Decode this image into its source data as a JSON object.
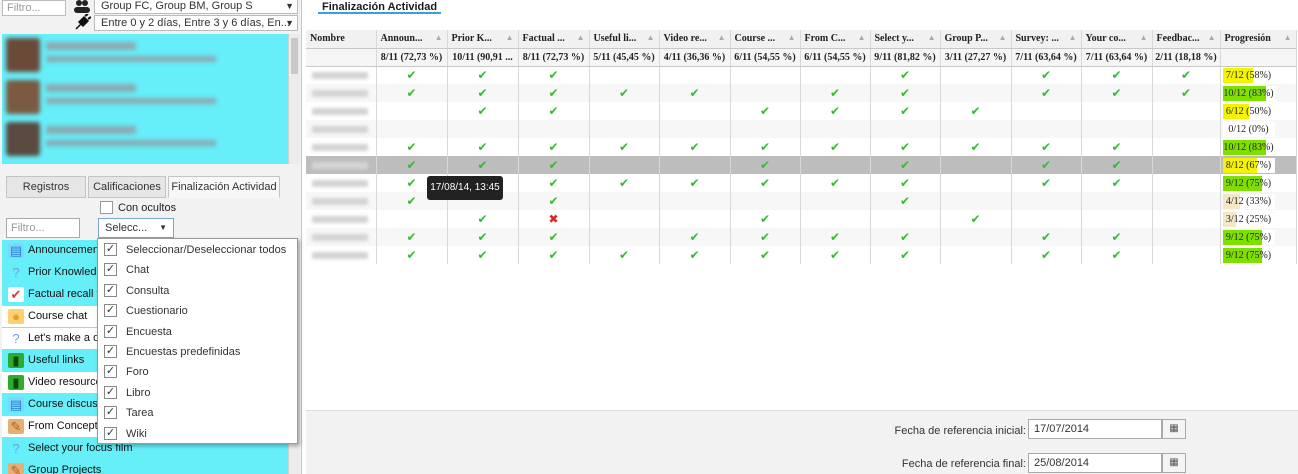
{
  "left": {
    "user_filter_placeholder": "Filtro...",
    "groups_combo": "Group FC, Group BM, Group S",
    "days_combo": "Entre 0 y 2 días, Entre 3 y 6 días, En...",
    "tabs": [
      "Registros",
      "Calificaciones",
      "Finalización Actividad"
    ],
    "show_hidden_label": "Con ocultos",
    "activity_filter_placeholder": "Filtro...",
    "select_button": "Selecc...",
    "activities": [
      {
        "label": "Announcements",
        "icon": "forum-icon"
      },
      {
        "label": "Prior Knowledge",
        "icon": "help-icon"
      },
      {
        "label": "Factual recall test",
        "icon": "quiz-icon"
      },
      {
        "label": "Course chat",
        "icon": "chat-icon"
      },
      {
        "label": "Let's make a date",
        "icon": "help-icon"
      },
      {
        "label": "Useful links",
        "icon": "book-icon"
      },
      {
        "label": "Video resources",
        "icon": "book-icon"
      },
      {
        "label": "Course discussion",
        "icon": "forum-icon"
      },
      {
        "label": "From Concept to Screen",
        "icon": "assignment-icon"
      },
      {
        "label": "Select your focus film",
        "icon": "help-icon"
      },
      {
        "label": "Group Projects",
        "icon": "assignment-icon"
      }
    ],
    "dropdown": [
      {
        "label": "Seleccionar/Deseleccionar todos",
        "checked": true
      },
      {
        "label": "Chat",
        "checked": true
      },
      {
        "label": "Consulta",
        "checked": true
      },
      {
        "label": "Cuestionario",
        "checked": true
      },
      {
        "label": "Encuesta",
        "checked": true
      },
      {
        "label": "Encuestas predefinidas",
        "checked": true
      },
      {
        "label": "Foro",
        "checked": true
      },
      {
        "label": "Libro",
        "checked": true
      },
      {
        "label": "Tarea",
        "checked": true
      },
      {
        "label": "Wiki",
        "checked": true
      }
    ]
  },
  "main": {
    "tab_label": "Finalización Actividad",
    "columns": [
      {
        "header": "Nombre",
        "sub": ""
      },
      {
        "header": "Announ...",
        "sub": "8/11 (72,73 %)"
      },
      {
        "header": "Prior K...",
        "sub": "10/11 (90,91 ..."
      },
      {
        "header": "Factual ...",
        "sub": "8/11 (72,73 %)"
      },
      {
        "header": "Useful li...",
        "sub": "5/11 (45,45 %)"
      },
      {
        "header": "Video re...",
        "sub": "4/11 (36,36 %)"
      },
      {
        "header": "Course ...",
        "sub": "6/11 (54,55 %)"
      },
      {
        "header": "From C...",
        "sub": "6/11 (54,55 %)"
      },
      {
        "header": "Select y...",
        "sub": "9/11 (81,82 %)"
      },
      {
        "header": "Group P...",
        "sub": "3/11 (27,27 %)"
      },
      {
        "header": "Survey: ...",
        "sub": "7/11 (63,64 %)"
      },
      {
        "header": "Your co...",
        "sub": "7/11 (63,64 %)"
      },
      {
        "header": "Feedbac...",
        "sub": "2/11 (18,18 %)"
      },
      {
        "header": "Progresión",
        "sub": ""
      }
    ],
    "rows": [
      {
        "cells": [
          1,
          1,
          1,
          0,
          0,
          0,
          0,
          1,
          0,
          1,
          1,
          1
        ],
        "progress": "7/12 (58%)",
        "fraction": 0.58,
        "color": "#f4f400"
      },
      {
        "cells": [
          1,
          1,
          1,
          1,
          1,
          0,
          1,
          1,
          0,
          1,
          1,
          1
        ],
        "progress": "10/12 (83%)",
        "fraction": 0.83,
        "color": "#7fe000"
      },
      {
        "cells": [
          0,
          1,
          1,
          0,
          0,
          1,
          1,
          1,
          1,
          0,
          0,
          0
        ],
        "progress": "6/12 (50%)",
        "fraction": 0.5,
        "color": "#f4f400"
      },
      {
        "cells": [
          0,
          0,
          0,
          0,
          0,
          0,
          0,
          0,
          0,
          0,
          0,
          0
        ],
        "progress": "0/12 (0%)",
        "fraction": 0,
        "color": "#ffffff"
      },
      {
        "cells": [
          1,
          1,
          1,
          1,
          1,
          1,
          1,
          1,
          1,
          1,
          1,
          0
        ],
        "progress": "10/12 (83%)",
        "fraction": 0.83,
        "color": "#7fe000"
      },
      {
        "cells": [
          1,
          1,
          1,
          0,
          0,
          1,
          0,
          1,
          0,
          1,
          1,
          0
        ],
        "progress": "8/12 (67%)",
        "fraction": 0.67,
        "color": "#f4f400"
      },
      {
        "cells": [
          1,
          1,
          1,
          1,
          1,
          1,
          1,
          1,
          0,
          1,
          1,
          0
        ],
        "progress": "9/12 (75%)",
        "fraction": 0.75,
        "color": "#7fe000"
      },
      {
        "cells": [
          1,
          0,
          1,
          0,
          0,
          0,
          0,
          1,
          0,
          0,
          0,
          0
        ],
        "progress": "4/12 (33%)",
        "fraction": 0.33,
        "color": "#f5e6c8"
      },
      {
        "cells": [
          0,
          1,
          2,
          0,
          0,
          1,
          0,
          0,
          1,
          0,
          0,
          0
        ],
        "progress": "3/12 (25%)",
        "fraction": 0.25,
        "color": "#f5e6c8"
      },
      {
        "cells": [
          1,
          1,
          1,
          0,
          1,
          1,
          1,
          1,
          0,
          1,
          1,
          0
        ],
        "progress": "9/12 (75%)",
        "fraction": 0.75,
        "color": "#7fe000"
      },
      {
        "cells": [
          1,
          1,
          1,
          1,
          1,
          1,
          1,
          1,
          0,
          1,
          1,
          0
        ],
        "progress": "9/12 (75%)",
        "fraction": 0.75,
        "color": "#7fe000"
      }
    ],
    "selected_row": 5,
    "tooltip": "17/08/14, 13:45",
    "start_date_label": "Fecha de referencia inicial:",
    "start_date": "17/07/2014",
    "end_date_label": "Fecha de referencia final:",
    "end_date": "25/08/2014"
  },
  "colors": {
    "list_bg": "#66eef9",
    "check": "#33bb33",
    "cross": "#dd2222",
    "tab_underline": "#36a2d8"
  }
}
